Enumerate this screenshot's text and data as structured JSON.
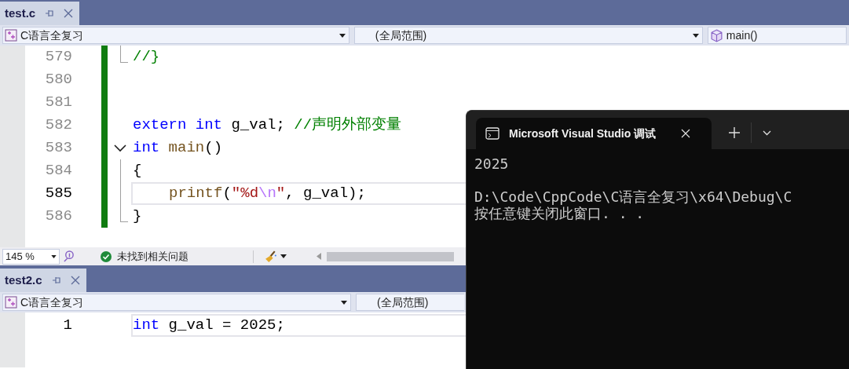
{
  "panes": [
    {
      "tab": {
        "label": "test.c"
      },
      "nav": [
        {
          "kind": "project",
          "text": "C语言全复习"
        },
        {
          "kind": "scope",
          "text": "(全局范围)"
        },
        {
          "kind": "member",
          "text": "main()"
        }
      ],
      "lines": [
        {
          "number": "579",
          "current": false,
          "changed": true,
          "collapsible": false,
          "in_block": false,
          "block_end": true,
          "indented": false,
          "tokens": [
            {
              "kind": "comment",
              "text": "//}"
            }
          ]
        },
        {
          "number": "580",
          "current": false,
          "changed": true,
          "collapsible": false,
          "in_block": false,
          "block_end": false,
          "indented": false
        },
        {
          "number": "581",
          "current": false,
          "changed": true,
          "collapsible": false,
          "in_block": false,
          "block_end": false,
          "indented": false
        },
        {
          "number": "582",
          "current": false,
          "changed": true,
          "collapsible": false,
          "in_block": false,
          "block_end": false,
          "indented": false,
          "tokens": [
            {
              "kind": "keyword",
              "text": "extern int"
            },
            {
              "kind": "plain",
              "text": " g_val; "
            },
            {
              "kind": "comment",
              "text": "//声明外部变量"
            }
          ]
        },
        {
          "number": "583",
          "current": false,
          "changed": true,
          "collapsible": true,
          "in_block": false,
          "block_end": false,
          "indented": false,
          "tokens": [
            {
              "kind": "keyword",
              "text": "int"
            },
            {
              "kind": "function",
              "text": " main"
            },
            {
              "kind": "plain",
              "text": "()"
            }
          ]
        },
        {
          "number": "584",
          "current": false,
          "changed": true,
          "collapsible": false,
          "in_block": true,
          "block_end": false,
          "indented": false,
          "tokens": [
            {
              "kind": "plain",
              "text": "{"
            }
          ]
        },
        {
          "number": "585",
          "current": true,
          "changed": true,
          "collapsible": false,
          "in_block": true,
          "block_end": false,
          "indented": true,
          "tokens": [
            {
              "kind": "function",
              "text": "printf"
            },
            {
              "kind": "plain",
              "text": "("
            },
            {
              "kind": "string",
              "text": "\"%d"
            },
            {
              "kind": "escape",
              "text": "\\n"
            },
            {
              "kind": "string",
              "text": "\""
            },
            {
              "kind": "plain",
              "text": ", g_val);"
            }
          ]
        },
        {
          "number": "586",
          "current": false,
          "changed": true,
          "collapsible": false,
          "in_block": false,
          "block_end": true,
          "indented": false,
          "tokens": [
            {
              "kind": "plain",
              "text": "}"
            }
          ]
        }
      ],
      "status": {
        "zoom": "145 %",
        "issues": "未找到相关问题"
      }
    },
    {
      "tab": {
        "label": "test2.c"
      },
      "nav": [
        {
          "kind": "project",
          "text": "C语言全复习"
        },
        {
          "kind": "scope",
          "text": "(全局范围)"
        }
      ],
      "lines": [
        {
          "number": "1",
          "current": true,
          "tokens": [
            {
              "kind": "keyword",
              "text": "int"
            },
            {
              "kind": "plain",
              "text": " g_val = 2025;"
            }
          ]
        }
      ]
    }
  ],
  "terminal": {
    "tab_title": "Microsoft Visual Studio 调试",
    "paragraphs": [
      {
        "lines": [
          "2025"
        ]
      },
      {
        "lines": [
          "D:\\Code\\CppCode\\C语言全复习\\x64\\Debug\\C",
          "按任意键关闭此窗口. . ."
        ]
      }
    ]
  }
}
